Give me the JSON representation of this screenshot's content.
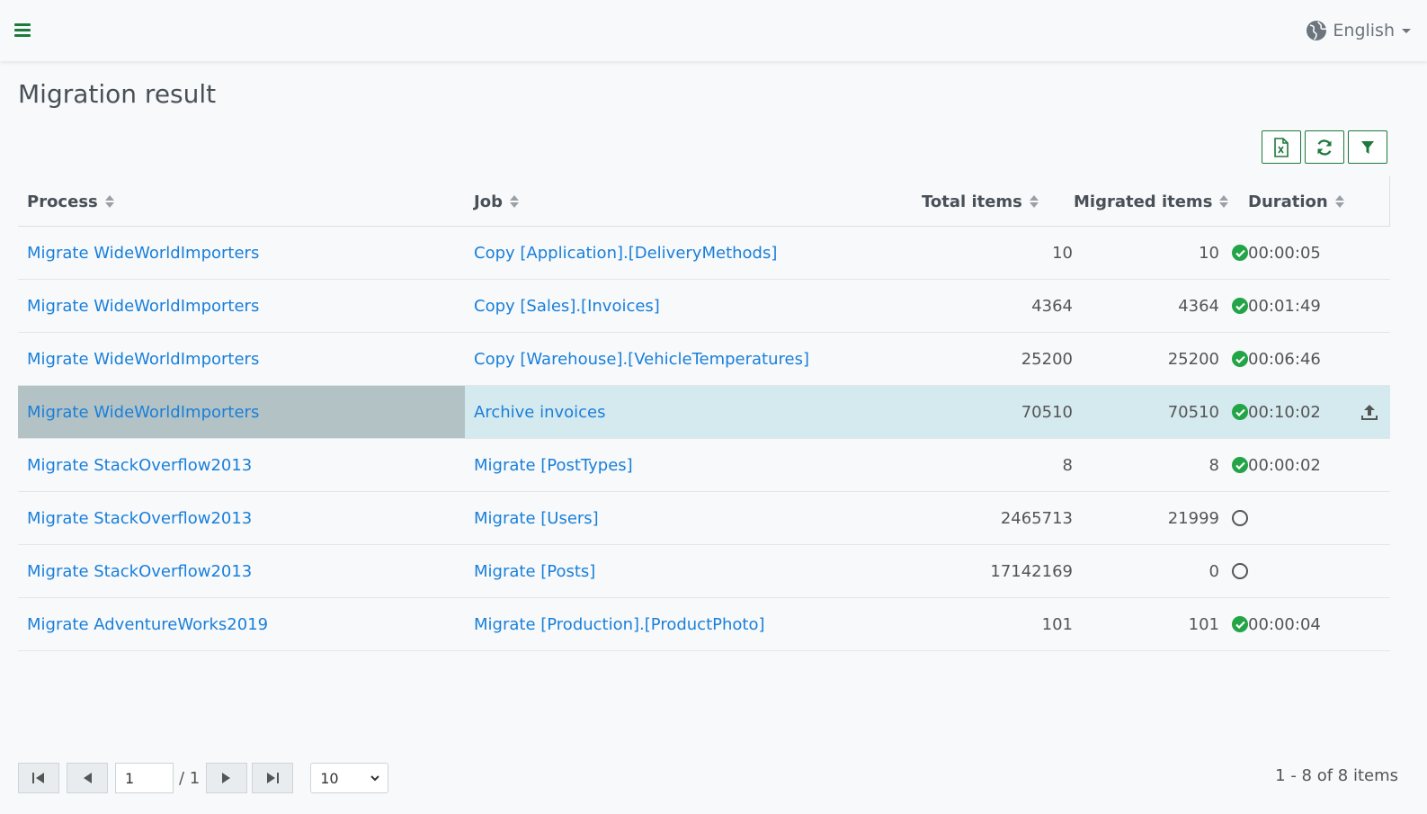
{
  "header": {
    "menu_icon": "hamburger-icon",
    "language": "English",
    "language_icon": "globe-icon"
  },
  "page": {
    "title": "Migration result"
  },
  "toolbar": {
    "buttons": [
      {
        "icon": "excel-export-icon"
      },
      {
        "icon": "refresh-icon"
      },
      {
        "icon": "filter-icon"
      }
    ]
  },
  "grid": {
    "columns": [
      "Process",
      "Job",
      "Total items",
      "Migrated items",
      "Duration"
    ],
    "rows": [
      {
        "process": "Migrate WideWorldImporters",
        "job": "Copy [Application].[DeliveryMethods]",
        "total": "10",
        "migrated": "10",
        "status": "complete",
        "duration": "00:00:05"
      },
      {
        "process": "Migrate WideWorldImporters",
        "job": "Copy [Sales].[Invoices]",
        "total": "4364",
        "migrated": "4364",
        "status": "complete",
        "duration": "00:01:49"
      },
      {
        "process": "Migrate WideWorldImporters",
        "job": "Copy [Warehouse].[VehicleTemperatures]",
        "total": "25200",
        "migrated": "25200",
        "status": "complete",
        "duration": "00:06:46"
      },
      {
        "process": "Migrate WideWorldImporters",
        "job": "Archive invoices",
        "total": "70510",
        "migrated": "70510",
        "status": "complete",
        "duration": "00:10:02",
        "selected": true,
        "action_icon": "upload-icon"
      },
      {
        "process": "Migrate StackOverflow2013",
        "job": "Migrate [PostTypes]",
        "total": "8",
        "migrated": "8",
        "status": "complete",
        "duration": "00:00:02"
      },
      {
        "process": "Migrate StackOverflow2013",
        "job": "Migrate [Users]",
        "total": "2465713",
        "migrated": "21999",
        "status": "pending",
        "duration": ""
      },
      {
        "process": "Migrate StackOverflow2013",
        "job": "Migrate [Posts]",
        "total": "17142169",
        "migrated": "0",
        "status": "pending",
        "duration": ""
      },
      {
        "process": "Migrate AdventureWorks2019",
        "job": "Migrate [Production].[ProductPhoto]",
        "total": "101",
        "migrated": "101",
        "status": "complete",
        "duration": "00:00:04"
      }
    ]
  },
  "pager": {
    "current_page": "1",
    "total_pages": "/ 1",
    "page_size": "10",
    "info": "1 - 8 of 8 items"
  },
  "colors": {
    "accent": "#1e7a3c",
    "link": "#1a7fd9",
    "success": "#22a447",
    "selected_row": "#d5eaef",
    "selected_cell": "#b2c2c5"
  }
}
